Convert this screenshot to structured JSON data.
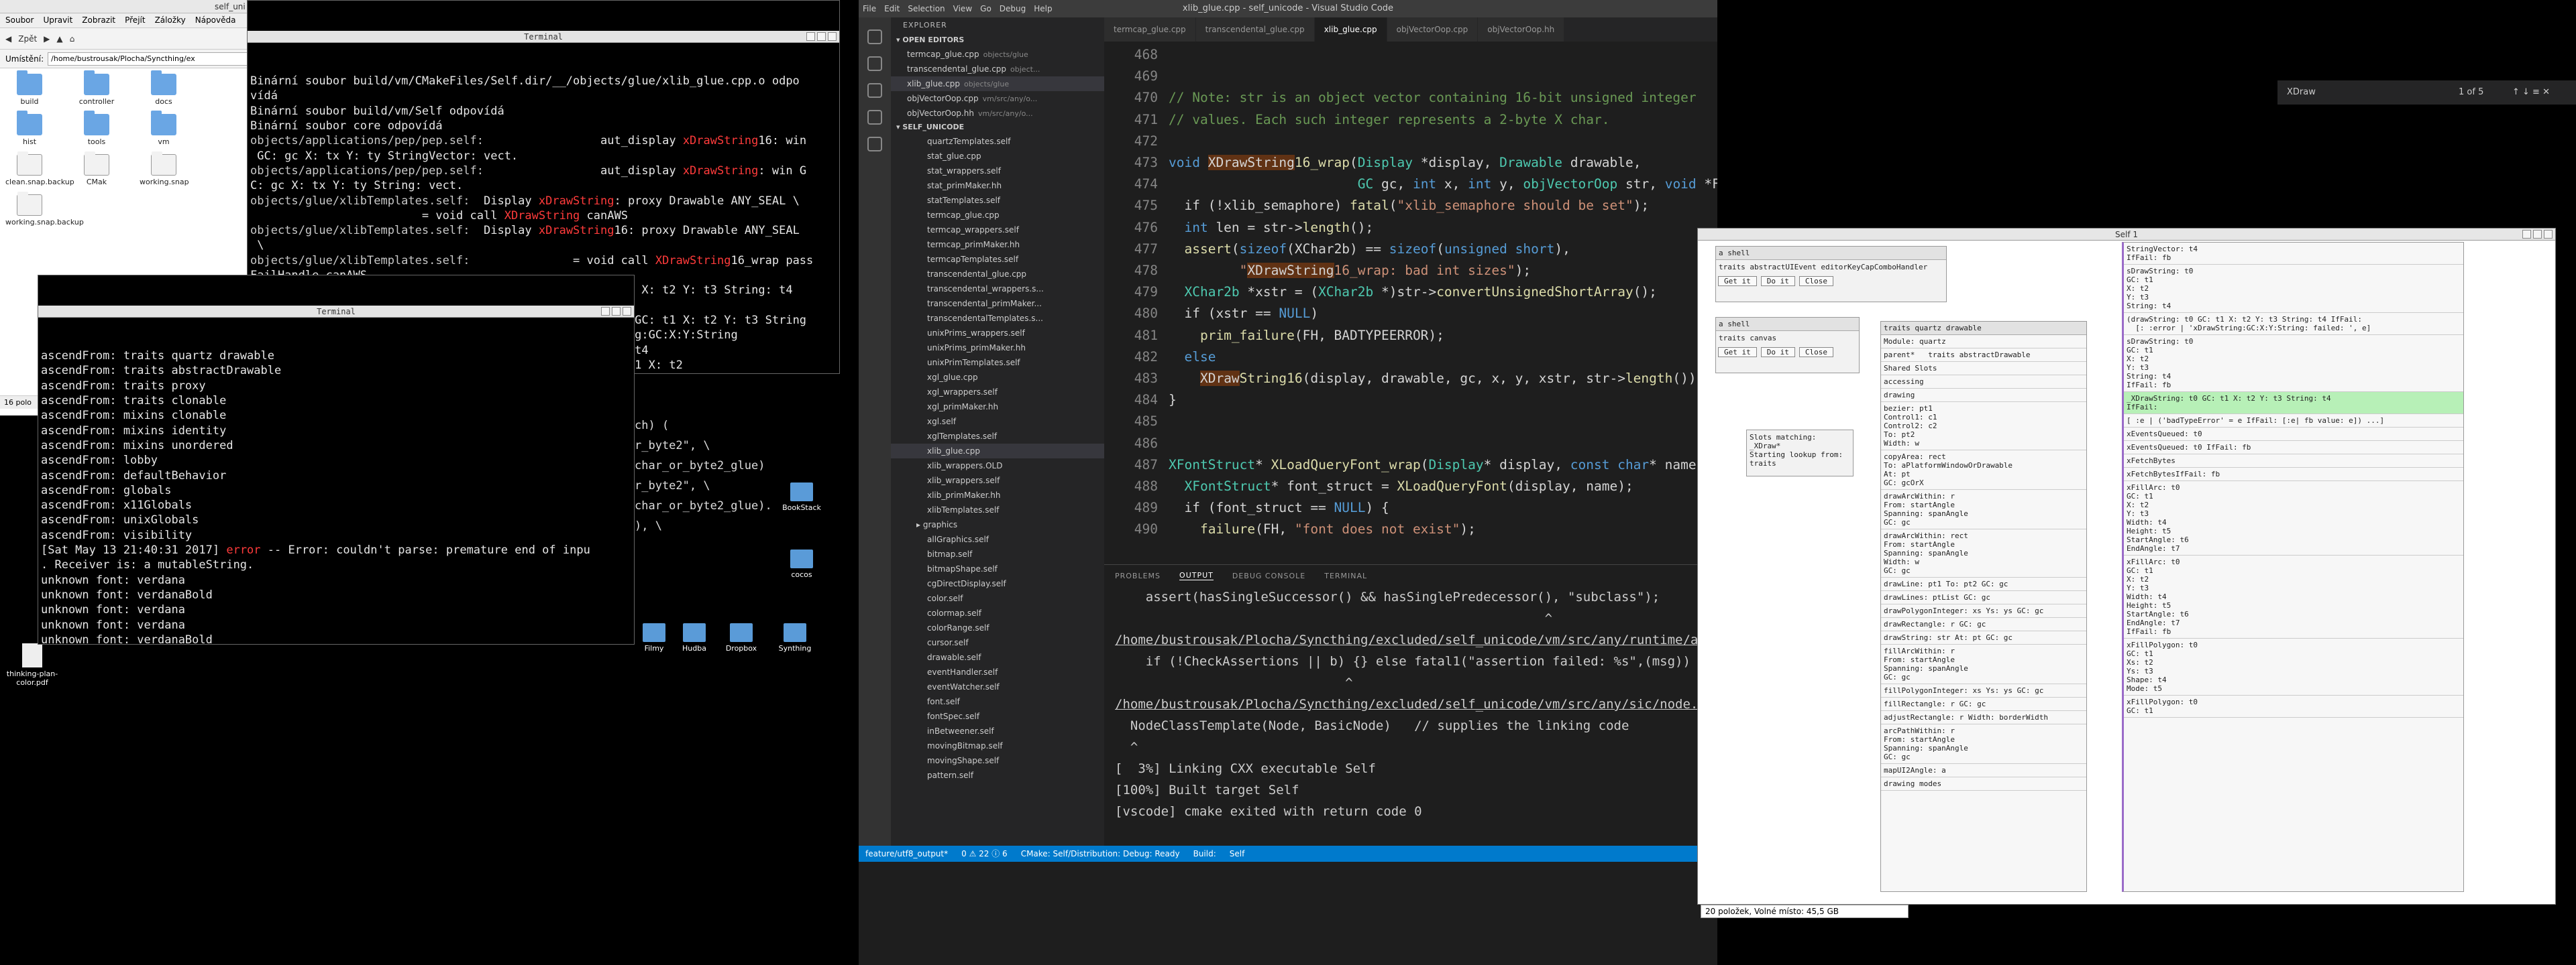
{
  "file_manager": {
    "title": "self_uni",
    "menu": [
      "Soubor",
      "Upravit",
      "Zobrazit",
      "Přejít",
      "Záložky",
      "Nápověda"
    ],
    "back_label": "Zpět",
    "location_label": "Umístění:",
    "location_value": "/home/bustrousak/Plocha/Syncthing/ex",
    "icons": [
      {
        "name": "build",
        "kind": "folder"
      },
      {
        "name": "controller",
        "kind": "folder"
      },
      {
        "name": "docs",
        "kind": "folder"
      },
      {
        "name": "hist",
        "kind": "folder"
      },
      {
        "name": "tools",
        "kind": "folder"
      },
      {
        "name": "vm",
        "kind": "folder"
      },
      {
        "name": "clean.snap.backup",
        "kind": "doc"
      },
      {
        "name": "CMak",
        "kind": "doc"
      },
      {
        "name": "working.snap",
        "kind": "doc"
      },
      {
        "name": "working.snap.backup",
        "kind": "doc"
      }
    ],
    "status": "16 polo"
  },
  "terminal1": {
    "title": "Terminal",
    "lines": [
      [
        [
          "Binární soubor build/vm/CMakeFiles/Self.dir/__/objects/glue/xlib_glue.cpp.o odpo",
          ""
        ]
      ],
      [
        [
          "vídá",
          ""
        ]
      ],
      [
        [
          "Binární soubor build/vm/Self odpovídá",
          ""
        ]
      ],
      [
        [
          "Binární soubor core odpovídá",
          ""
        ]
      ],
      [
        [
          "objects/applications/pep/pep.self:",
          "g"
        ],
        [
          "                 aut_display ",
          ""
        ],
        [
          "xDrawString",
          "r"
        ],
        [
          "16: win",
          ""
        ]
      ],
      [
        [
          " GC: gc X: tx Y: ty StringVector: vect.",
          ""
        ]
      ],
      [
        [
          "objects/applications/pep/pep.self:",
          "g"
        ],
        [
          "                 aut_display ",
          ""
        ],
        [
          "xDrawString",
          "r"
        ],
        [
          ": win G",
          ""
        ]
      ],
      [
        [
          "C: gc X: tx Y: ty String: vect.",
          ""
        ]
      ],
      [
        [
          "objects/glue/xlibTemplates.self:",
          "g"
        ],
        [
          "  Display ",
          ""
        ],
        [
          "xDrawString",
          "r"
        ],
        [
          ": proxy Drawable ANY_SEAL \\",
          ""
        ]
      ],
      [
        [
          "                         = void call ",
          ""
        ],
        [
          "XDrawString",
          "r"
        ],
        [
          " canAWS",
          ""
        ]
      ],
      [
        [
          "objects/glue/xlibTemplates.self:",
          "g"
        ],
        [
          "  Display ",
          ""
        ],
        [
          "xDrawString",
          "r"
        ],
        [
          "16: proxy Drawable ANY_SEAL",
          ""
        ]
      ],
      [
        [
          " \\",
          ""
        ]
      ],
      [
        [
          "objects/glue/xlibTemplates.self:",
          "g"
        ],
        [
          "               = void call ",
          ""
        ],
        [
          "XDrawString",
          "r"
        ],
        [
          "16_wrap pass",
          ""
        ]
      ],
      [
        [
          "FailHandle canAWS",
          ""
        ]
      ],
      [
        [
          "objects/glue/xlib_wrappers.self:",
          "g"
        ],
        [
          "  ",
          ""
        ],
        [
          "xDrawString",
          "r"
        ],
        [
          ": t0 GC: t1 X: t2 Y: t3 String: t4",
          ""
        ]
      ],
      [
        [
          " = (",
          ""
        ]
      ],
      [
        [
          "objects/glue/xlib_wrappers.self:",
          "g"
        ],
        [
          "        ",
          ""
        ],
        [
          "xDrawString",
          "r"
        ],
        [
          ": t0 GC: t1 X: t2 Y: t3 String",
          ""
        ]
      ],
      [
        [
          "",
          ""
        ]
      ],
      [
        [
          "objects/",
          "g"
        ],
        [
          "                                     'xDrawString:GC:X:Y:String",
          ""
        ]
      ],
      [
        [
          "",
          ""
        ]
      ],
      [
        [
          "                                    X: t2 Y: t3 String: t4",
          ""
        ]
      ],
      [
        [
          "",
          ""
        ]
      ],
      [
        [
          "                                    ",
          ""
        ],
        [
          "DrawString",
          "r"
        ],
        [
          ": t0 GC: t1 X: t2",
          ""
        ]
      ]
    ]
  },
  "terminal2": {
    "title": "Terminal",
    "lines": [
      "ascendFrom: traits quartz drawable",
      "ascendFrom: traits abstractDrawable",
      "ascendFrom: traits proxy",
      "ascendFrom: traits clonable",
      "ascendFrom: mixins clonable",
      "ascendFrom: mixins identity",
      "ascendFrom: mixins unordered",
      "ascendFrom: lobby",
      "ascendFrom: defaultBehavior",
      "ascendFrom: globals",
      "ascendFrom: x11Globals",
      "ascendFrom: unixGlobals",
      "ascendFrom: visibility"
    ],
    "error_prefix": "[Sat May 13 21:40:31 2017] ",
    "error_word": "error",
    "error_text": " -- Error: couldn't parse: premature end of inpu",
    "error_line2": ". Receiver is: a mutableString.",
    "font_lines": [
      "unknown font: verdana",
      "unknown font: verdanaBold",
      "unknown font: verdana",
      "unknown font: verdana",
      "unknown font: verdanaBold",
      "unknown font: verdana",
      "unknown font: verdanaBold"
    ],
    "behind_right": [
      "ch) (",
      "r_byte2\", \\",
      "char_or_byte2_glue)",
      "r_byte2\", \\",
      "char_or_byte2_glue).",
      "), \\"
    ]
  },
  "desktop_icons": [
    {
      "name": "Filmy"
    },
    {
      "name": "Hudba"
    },
    {
      "name": "Dropbox"
    },
    {
      "name": "Synthing"
    },
    {
      "name": "BookStack"
    },
    {
      "name": "cocos"
    }
  ],
  "desktop_file": "thinking-plan-color.pdf",
  "vscode": {
    "title": "xlib_glue.cpp - self_unicode - Visual Studio Code",
    "menu": [
      "File",
      "Edit",
      "Selection",
      "View",
      "Go",
      "Debug",
      "Help"
    ],
    "explorer_title": "EXPLORER",
    "open_editors_label": "OPEN EDITORS",
    "open_editors": [
      {
        "name": "termcap_glue.cpp",
        "dir": "objects/glue"
      },
      {
        "name": "transcendental_glue.cpp",
        "dir": "object..."
      },
      {
        "name": "xlib_glue.cpp",
        "dir": "objects/glue"
      },
      {
        "name": "objVectorOop.cpp",
        "dir": "vm/src/any/o..."
      },
      {
        "name": "objVectorOop.hh",
        "dir": "vm/src/any/o..."
      }
    ],
    "project_label": "SELF_UNICODE",
    "files": [
      "quartzTemplates.self",
      "stat_glue.cpp",
      "stat_wrappers.self",
      "stat_primMaker.hh",
      "statTemplates.self",
      "termcap_glue.cpp",
      "termcap_wrappers.self",
      "termcap_primMaker.hh",
      "termcapTemplates.self",
      "transcendental_glue.cpp",
      "transcendental_wrappers.s...",
      "transcendental_primMaker...",
      "transcendentalTemplates.s...",
      "unixPrims_wrappers.self",
      "unixPrims_primMaker.hh",
      "unixPrimTemplates.self",
      "xgl_glue.cpp",
      "xgl_wrappers.self",
      "xgl_primMaker.hh",
      "xgl.self",
      "xglTemplates.self",
      "xlib_glue.cpp",
      "xlib_wrappers.OLD",
      "xlib_wrappers.self",
      "xlib_primMaker.hh",
      "xlibTemplates.self"
    ],
    "selected_file": "xlib_glue.cpp",
    "graphics_label": "graphics",
    "graphics_files": [
      "allGraphics.self",
      "bitmap.self",
      "bitmapShape.self",
      "cgDirectDisplay.self",
      "color.self",
      "colormap.self",
      "colorRange.self",
      "cursor.self",
      "drawable.self",
      "eventHandler.self",
      "eventWatcher.self",
      "font.self",
      "fontSpec.self",
      "inBetweener.self",
      "movingBitmap.self",
      "movingShape.self",
      "pattern.self"
    ],
    "tabs": [
      "termcap_glue.cpp",
      "transcendental_glue.cpp",
      "xlib_glue.cpp",
      "objVectorOop.cpp",
      "objVectorOop.hh"
    ],
    "active_tab": "xlib_glue.cpp",
    "code_lines": [
      {
        "n": "468",
        "t": [
          [
            "",
            ""
          ]
        ]
      },
      {
        "n": "469",
        "t": [
          [
            "",
            ""
          ]
        ]
      },
      {
        "n": "470",
        "t": [
          [
            "// Note: str is an object vector containing 16-bit unsigned integer",
            "cm"
          ]
        ]
      },
      {
        "n": "471",
        "t": [
          [
            "// values. Each such integer represents a 2-byte X char.",
            "cm"
          ]
        ]
      },
      {
        "n": "472",
        "t": [
          [
            "",
            ""
          ]
        ]
      },
      {
        "n": "473",
        "t": [
          [
            "void ",
            "kw"
          ],
          [
            "XDrawString",
            "hl"
          ],
          [
            "16_wrap",
            "fn"
          ],
          [
            "(",
            "pl"
          ],
          [
            "Display",
            "ty"
          ],
          [
            " *display, ",
            "pl"
          ],
          [
            "Drawable",
            "ty"
          ],
          [
            " drawable,",
            "pl"
          ]
        ]
      },
      {
        "n": "474",
        "t": [
          [
            "                        GC",
            "ty"
          ],
          [
            " gc, ",
            "pl"
          ],
          [
            "int",
            "kw"
          ],
          [
            " x, ",
            "pl"
          ],
          [
            "int",
            "kw"
          ],
          [
            " y, ",
            "pl"
          ],
          [
            "objVectorOop",
            "ty"
          ],
          [
            " str, ",
            "pl"
          ],
          [
            "void",
            "kw"
          ],
          [
            " *FH) {",
            "pl"
          ]
        ]
      },
      {
        "n": "475",
        "t": [
          [
            "  if (!xlib_semaphore) ",
            "pl"
          ],
          [
            "fatal",
            "fn"
          ],
          [
            "(",
            "pl"
          ],
          [
            "\"xlib_semaphore should be set\"",
            "st"
          ],
          [
            ");",
            "pl"
          ]
        ]
      },
      {
        "n": "476",
        "t": [
          [
            "  int",
            "kw"
          ],
          [
            " len = str->",
            "pl"
          ],
          [
            "length",
            "fn"
          ],
          [
            "();",
            "pl"
          ]
        ]
      },
      {
        "n": "477",
        "t": [
          [
            "  assert",
            "fn"
          ],
          [
            "(",
            "pl"
          ],
          [
            "sizeof",
            "kw"
          ],
          [
            "(XChar2b) == ",
            "pl"
          ],
          [
            "sizeof",
            "kw"
          ],
          [
            "(",
            "pl"
          ],
          [
            "unsigned short",
            "kw"
          ],
          [
            "),",
            "pl"
          ]
        ]
      },
      {
        "n": "478",
        "t": [
          [
            "         \"",
            "st"
          ],
          [
            "XDrawString",
            "hl"
          ],
          [
            "16_wrap: bad int sizes\"",
            "st"
          ],
          [
            ");",
            "pl"
          ]
        ]
      },
      {
        "n": "479",
        "t": [
          [
            "  XChar2b",
            "ty"
          ],
          [
            " *xstr = (",
            "pl"
          ],
          [
            "XChar2b",
            "ty"
          ],
          [
            " *)str->",
            "pl"
          ],
          [
            "convertUnsignedShortArray",
            "fn"
          ],
          [
            "();",
            "pl"
          ]
        ]
      },
      {
        "n": "480",
        "t": [
          [
            "  if (xstr == ",
            "pl"
          ],
          [
            "NULL",
            "kw"
          ],
          [
            ")",
            "pl"
          ]
        ]
      },
      {
        "n": "481",
        "t": [
          [
            "    prim_failure",
            "fn"
          ],
          [
            "(FH, BADTYPEERROR);",
            "pl"
          ]
        ]
      },
      {
        "n": "482",
        "t": [
          [
            "  else",
            "kw"
          ]
        ]
      },
      {
        "n": "483",
        "t": [
          [
            "    ",
            "pl"
          ],
          [
            "XDraw",
            "hl"
          ],
          [
            "String16",
            "fn"
          ],
          [
            "(display, drawable, gc, x, y, xstr, str->",
            "pl"
          ],
          [
            "length",
            "fn"
          ],
          [
            "());",
            "pl"
          ]
        ]
      },
      {
        "n": "484",
        "t": [
          [
            "}",
            "pl"
          ]
        ]
      },
      {
        "n": "485",
        "t": [
          [
            "",
            ""
          ]
        ]
      },
      {
        "n": "486",
        "t": [
          [
            "",
            ""
          ]
        ]
      },
      {
        "n": "487",
        "t": [
          [
            "XFontStruct",
            "ty"
          ],
          [
            "* ",
            "pl"
          ],
          [
            "XLoadQueryFont_wrap",
            "fn"
          ],
          [
            "(",
            "pl"
          ],
          [
            "Display",
            "ty"
          ],
          [
            "* display, ",
            "pl"
          ],
          [
            "const char",
            "kw"
          ],
          [
            "* name, ",
            "pl"
          ],
          [
            "void",
            "kw"
          ]
        ]
      },
      {
        "n": "488",
        "t": [
          [
            "  XFontStruct",
            "ty"
          ],
          [
            "* font_struct = ",
            "pl"
          ],
          [
            "XLoadQueryFont",
            "fn"
          ],
          [
            "(display, name);",
            "pl"
          ]
        ]
      },
      {
        "n": "489",
        "t": [
          [
            "  if (font_struct == ",
            "pl"
          ],
          [
            "NULL",
            "kw"
          ],
          [
            ") {",
            "pl"
          ]
        ]
      },
      {
        "n": "490",
        "t": [
          [
            "    failure",
            "fn"
          ],
          [
            "(FH, ",
            "pl"
          ],
          [
            "\"font does not exist\"",
            "st"
          ],
          [
            ");",
            "pl"
          ]
        ]
      }
    ],
    "panel_tabs": [
      "PROBLEMS",
      "OUTPUT",
      "DEBUG CONSOLE",
      "TERMINAL"
    ],
    "active_panel_tab": "OUTPUT",
    "output_lines": [
      "    assert(hasSingleSuccessor() && hasSinglePredecessor(), \"subclass\");",
      "                                                        ^",
      "/home/bustrousak/Plocha/Syncthing/excluded/self_unicode/vm/src/any/runtime/asse",
      "    if (!CheckAssertions || b) {} else fatal1(\"assertion failed: %s\",(msg))",
      "                              ^",
      "/home/bustrousak/Plocha/Syncthing/excluded/self_unicode/vm/src/any/sic/node.hh:",
      "  NodeClassTemplate(Node, BasicNode)   // supplies the linking code",
      "  ^",
      "[  3%] Linking CXX executable Self",
      "[100%] Built target Self",
      "[vscode] cmake exited with return code 0"
    ],
    "status_items": [
      "feature/utf8_output*",
      "0 ⚠ 22 ⓘ 6",
      "CMake: Self/Distribution: Debug: Ready",
      "Build:",
      "Self"
    ]
  },
  "find_widget": {
    "query": "XDraw",
    "count": "1 of 5"
  },
  "self_world": {
    "title": "Self 1",
    "shell1": {
      "title": "a shell",
      "content": "traits abstractUIEvent editorKeyCapComboHandler",
      "buttons": [
        "Get it",
        "Do it",
        "Close"
      ]
    },
    "shell2": {
      "title": "a shell",
      "content": "traits canvas",
      "buttons": [
        "Get it",
        "Do it",
        "Close"
      ]
    },
    "slots_matching": [
      "Slots matching:",
      "_XDraw*",
      "Starting lookup from:",
      "traits"
    ],
    "outliner": {
      "title": "traits quartz drawable",
      "module": "Module: quartz",
      "parent": "parent*",
      "parent_value": "traits abstractDrawable",
      "sections": [
        "Shared Slots",
        "accessing",
        "drawing"
      ],
      "slots": [
        "bezier: pt1\nControl1: c1\nControl2: c2\nTo: pt2\nWidth: w",
        "copyArea: rect\nTo: aPlatformWindowOrDrawable\nAt: pt\nGC: gcOrX",
        "drawArcWithin: r\nFrom: startAngle\nSpanning: spanAngle\nGC: gc",
        "drawArcWithin: rect\nFrom: startAngle\nSpanning: spanAngle\nWidth: w\nGC: gc",
        "drawLine: pt1 To: pt2 GC: gc",
        "drawLines: ptList GC: gc",
        "drawPolygonInteger: xs Ys: ys GC: gc",
        "drawRectangle: r GC: gc",
        "drawString: str At: pt GC: gc",
        "fillArcWithin: r\nFrom: startAngle\nSpanning: spanAngle\nGC: gc",
        "fillPolygonInteger: xs Ys: ys GC: gc",
        "fillRectangle: r GC: gc",
        "adjustRectangle: r Width: borderWidth",
        "arcPathWithin: r\nFrom: startAngle\nSpanning: spanAngle\nGC: gc",
        "mapUI2Angle: a",
        "drawing modes"
      ]
    },
    "right_slots": [
      "StringVector: t4\nIfFail: fb",
      "sDrawString: t0\nGC: t1\nX: t2\nY: t3\nString: t4",
      "(drawString: t0 GC: t1 X: t2 Y: t3 String: t4 IfFail:\n  [: :error | 'xDrawString:GC:X:Y:String: failed: ', e]",
      "sDrawString: t0\nGC: t1\nX: t2\nY: t3\nString: t4\nIfFail: fb",
      "_XDrawString: t0 GC: t1 X: t2 Y: t3 String: t4\nIfFail:",
      "[ :e | ('badTypeError' = e IfFail: [:e| fb value: e]) ...]",
      "xEventsQueued: t0",
      "xEventsQueued: t0 IfFail: fb",
      "xFetchBytes",
      "xFetchBytesIfFail: fb",
      "xFillArc: t0\nGC: t1\nX: t2\nY: t3\nWidth: t4\nHeight: t5\nStartAngle: t6\nEndAngle: t7",
      "xFillArc: t0\nGC: t1\nX: t2\nY: t3\nWidth: t4\nHeight: t5\nStartAngle: t6\nEndAngle: t7\nIfFail: fb",
      "xFillPolygon: t0\nGC: t1\nXs: t2\nYs: t3\nShape: t4\nMode: t5",
      "xFillPolygon: t0\nGC: t1"
    ]
  },
  "taskbar_status": "20 položek, Volné místo: 45,5 GB"
}
